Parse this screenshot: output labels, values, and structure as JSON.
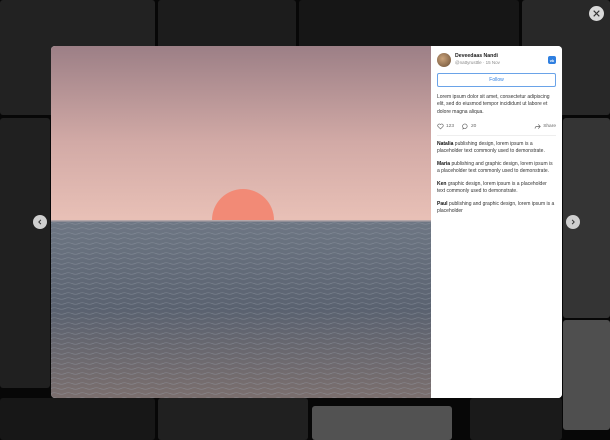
{
  "post": {
    "author": "Deveedaas Nandi",
    "handle_date": "@nattyrusttle · 15 Nov",
    "follow_label": "Follow",
    "caption": "Lorem ipsum dolor sit amet, consectetur adipiscing elit, sed do eiusmod tempor incididunt ut labore et dolore magna aliqua.",
    "likes": "123",
    "comments_count": "20",
    "share_label": "Share",
    "badge": "vk"
  },
  "comments": [
    {
      "user": "Natalia",
      "text": "publishing design, lorem ipsum is a placeholder text commonly used to demonstrate."
    },
    {
      "user": "Maria",
      "text": "publishing and graphic design, lorem ipsum is a placeholder text commonly used to demonstrate."
    },
    {
      "user": "Ken",
      "text": "graphic design, lorem ipsum is a placeholder text commonly used to demonstrate."
    },
    {
      "user": "Paul",
      "text": "publishing and graphic design, lorem ipsum is a placeholder"
    }
  ],
  "colors": {
    "accent": "#2f7fe0",
    "sky_top": "#a08288",
    "sky_horizon": "#e7bcb4",
    "sun": "#f28a76",
    "sea": "#5b6470"
  },
  "icons": {
    "close": "close-icon",
    "prev": "chevron-left-icon",
    "next": "chevron-right-icon",
    "like": "heart-icon",
    "comment": "comment-icon",
    "share": "share-icon"
  }
}
